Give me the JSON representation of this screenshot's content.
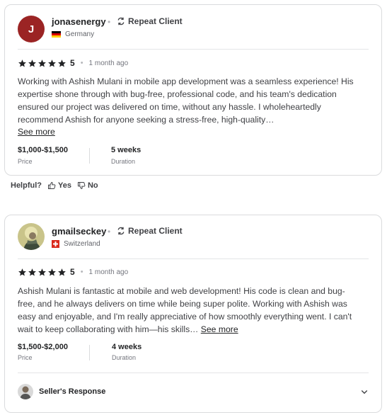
{
  "reviews": [
    {
      "avatar_letter": "J",
      "avatar_color": "#9b2424",
      "username": "jonasenergy",
      "badge": "Repeat Client",
      "country": "Germany",
      "flag": "germany-flag",
      "rating": "5",
      "rating_value": 5,
      "time_ago": "1 month ago",
      "text": "Working with Ashish Mulani in mobile app development was a seamless experience! His expertise shone through with bug-free, professional code, and his team's dedication ensured our project was delivered on time, without any hassle. I wholeheartedly recommend Ashish for anyone seeking a stress-free, high-quality…",
      "see_more": "See more",
      "price": "$1,000-$1,500",
      "price_label": "Price",
      "duration": "5 weeks",
      "duration_label": "Duration"
    },
    {
      "username": "gmailseckey",
      "badge": "Repeat Client",
      "country": "Switzerland",
      "flag": "switzerland-flag",
      "rating": "5",
      "rating_value": 5,
      "time_ago": "1 month ago",
      "text": "Ashish Mulani is fantastic at mobile and web development! His code is clean and bug-free, and he always delivers on time while being super polite. Working with Ashish was easy and enjoyable, and I'm really appreciative of how smoothly everything went. I can't wait to keep collaborating with him—his skills…",
      "see_more": "See more",
      "price": "$1,500-$2,000",
      "price_label": "Price",
      "duration": "4 weeks",
      "duration_label": "Duration",
      "seller_response": "Seller's Response"
    }
  ],
  "helpful": {
    "label": "Helpful?",
    "yes": "Yes",
    "no": "No"
  },
  "colors": {
    "star": "#222325",
    "text": "#404145",
    "border": "#dadbdd"
  }
}
